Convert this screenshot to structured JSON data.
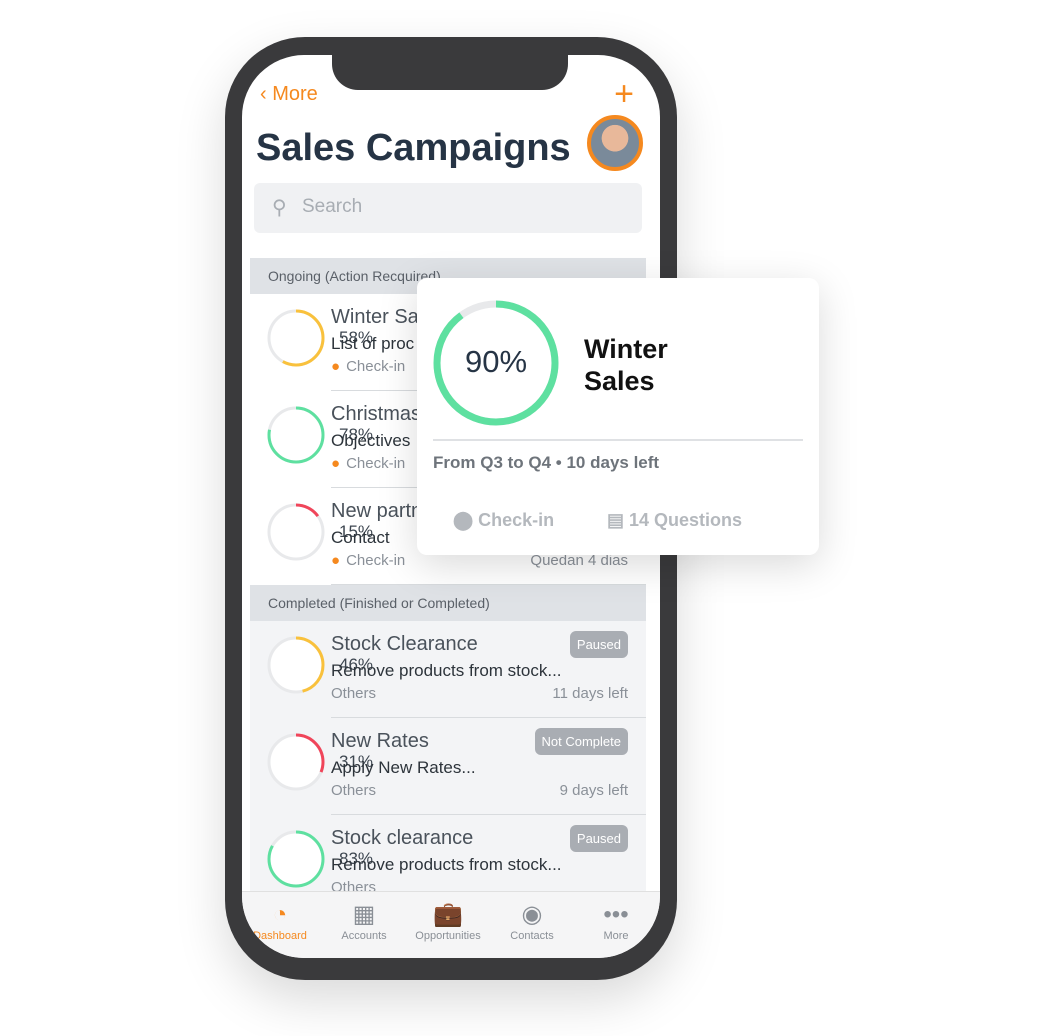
{
  "header": {
    "back_label": "More",
    "add_icon": "plus-icon",
    "title": "Sales Campaigns"
  },
  "search": {
    "placeholder": "Search"
  },
  "colors": {
    "accent": "#f5891f",
    "green": "#5ee0a0",
    "yellow": "#f9c13c",
    "red": "#f0455a"
  },
  "sections": [
    {
      "title": "Ongoing (Action Recquired)",
      "items": [
        {
          "progress": 58,
          "label": "58%",
          "title": "Winter Sa",
          "subtitle": "List of proc",
          "meta": "Check-in",
          "right": "",
          "color": "#f9c13c"
        },
        {
          "progress": 78,
          "label": "78%",
          "title": "Christmas",
          "subtitle": "Objectives",
          "meta": "Check-in",
          "right": "",
          "color": "#5ee0a0"
        },
        {
          "progress": 15,
          "label": "15%",
          "title": "New partn",
          "subtitle": "Contact",
          "meta": "Check-in",
          "right": "Quedan 4 dias",
          "color": "#f0455a"
        }
      ]
    },
    {
      "title": "Completed (Finished or Completed)",
      "items": [
        {
          "progress": 46,
          "label": "46%",
          "title": "Stock Clearance",
          "subtitle": "Remove products from stock...",
          "meta": "Others",
          "right": "11 days left",
          "badge": "Paused",
          "color": "#f9c13c"
        },
        {
          "progress": 31,
          "label": "31%",
          "title": "New Rates",
          "subtitle": "Apply New Rates...",
          "meta": "Others",
          "right": "9 days left",
          "badge": "Not Complete",
          "color": "#f0455a"
        },
        {
          "progress": 83,
          "label": "83%",
          "title": "Stock clearance",
          "subtitle": "Remove products from stock...",
          "meta": "Others",
          "right": "",
          "badge": "Paused",
          "color": "#5ee0a0"
        }
      ]
    }
  ],
  "tabs": [
    {
      "label": "Dashboard",
      "icon": "dashboard-icon",
      "active": true
    },
    {
      "label": "Accounts",
      "icon": "building-icon"
    },
    {
      "label": "Opportunities",
      "icon": "briefcase-icon"
    },
    {
      "label": "Contacts",
      "icon": "person-icon"
    },
    {
      "label": "More",
      "icon": "more-icon"
    }
  ],
  "popup": {
    "progress": 90,
    "label": "90%",
    "title": "Winter Sales",
    "description": "From Q3 to Q4 • 10 days left",
    "checkin": "Check-in",
    "questions": "14 Questions"
  }
}
